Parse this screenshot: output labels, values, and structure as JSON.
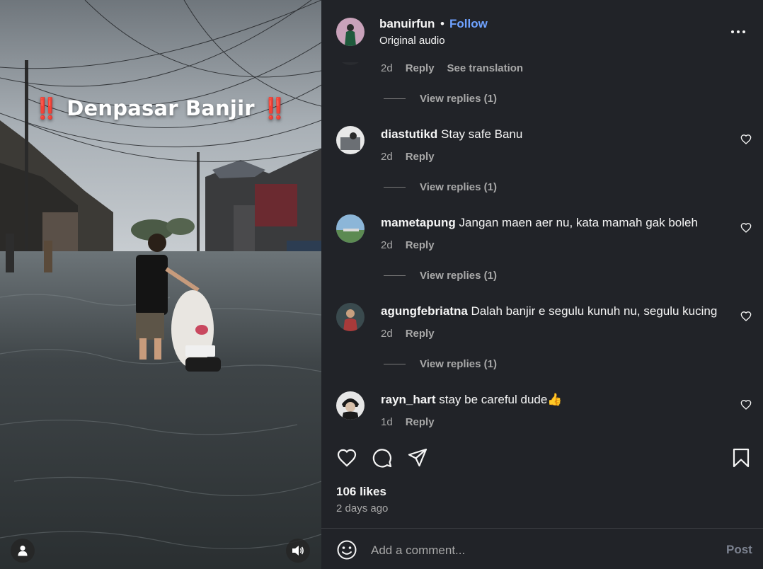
{
  "media": {
    "caption_bang": "‼️",
    "caption_text": "Denpasar Banjir"
  },
  "header": {
    "username": "banuirfun",
    "separator": "•",
    "follow_label": "Follow",
    "subtitle": "Original audio",
    "more_icon": "more-horizontal-icon"
  },
  "comments": {
    "partial": {
      "time": "2d",
      "reply": "Reply",
      "translate": "See translation",
      "view_replies": "View replies (1)"
    },
    "items": [
      {
        "user": "diastutikd",
        "text": "Stay safe Banu",
        "time": "2d",
        "reply": "Reply",
        "view_replies": "View replies (1)"
      },
      {
        "user": "mametapung",
        "text": "Jangan maen aer nu, kata mamah gak boleh",
        "time": "2d",
        "reply": "Reply",
        "view_replies": "View replies (1)"
      },
      {
        "user": "agungfebriatna",
        "text": "Dalah banjir e segulu kunuh nu, segulu kucing",
        "time": "2d",
        "reply": "Reply",
        "view_replies": "View replies (1)"
      },
      {
        "user": "rayn_hart",
        "text": "stay be careful dude👍",
        "time": "1d",
        "reply": "Reply"
      }
    ]
  },
  "stats": {
    "likes": "106 likes",
    "posted": "2 days ago"
  },
  "composer": {
    "placeholder": "Add a comment...",
    "post_label": "Post"
  },
  "colors": {
    "panel_bg": "#212328",
    "accent": "#6fa2ff",
    "muted": "#a8a8a8"
  }
}
